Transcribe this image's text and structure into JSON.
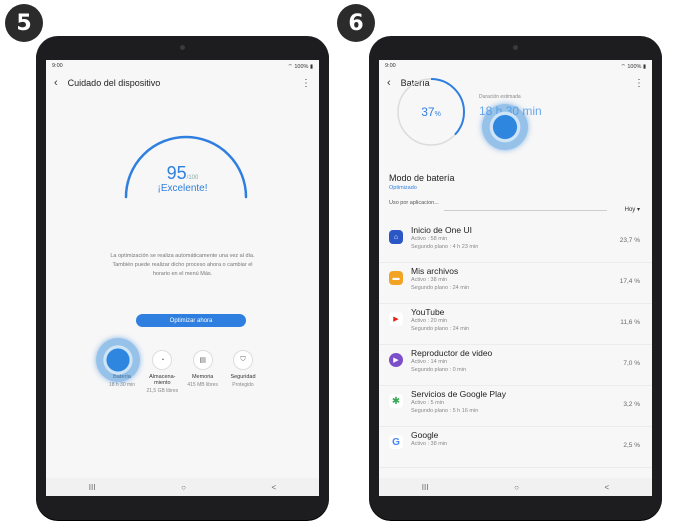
{
  "steps": {
    "left": "5",
    "right": "6"
  },
  "status": {
    "time": "9:00",
    "battery": "100%"
  },
  "icons": {
    "back": "back-arrow-icon",
    "more": "more-vert-icon",
    "recent": "recent-apps-icon",
    "home": "home-icon",
    "navback": "nav-back-icon"
  },
  "nav": {
    "recent": "III",
    "home": "○",
    "back": "<"
  },
  "device_care": {
    "title": "Cuidado del dispositivo",
    "score": "95",
    "score_max": "/100",
    "score_label": "¡Excelente!",
    "description": "La optimización se realiza automáticamente una vez al día. También puede realizar dicho proceso ahora o cambiar el horario en el menú Más.",
    "optimize_button": "Optimizar ahora",
    "categories": [
      {
        "label": "Batería",
        "value": "18 h 30 min",
        "icon": "battery-icon"
      },
      {
        "label": "Almacena-\nmiento",
        "value": "21,5 GB libres",
        "icon": "storage-icon"
      },
      {
        "label": "Memoria",
        "value": "415 MB libres",
        "icon": "memory-icon"
      },
      {
        "label": "Seguridad",
        "value": "Protegido",
        "icon": "shield-icon"
      }
    ],
    "gauge_color": "#2f7fe0"
  },
  "battery": {
    "title": "Batería",
    "percent": "37",
    "percent_unit": "%",
    "percent_fraction": 0.37,
    "duration_label": "Duración estimada",
    "duration_value": "18 h 30 min",
    "mode_title": "Modo de batería",
    "mode_value": "Optimizado",
    "usage_label": "Uso por aplicacion...",
    "usage_period": "Hoy",
    "apps": [
      {
        "name": "Inicio de One UI",
        "active": "Activo : 58 min",
        "background": "Segundo plano : 4 h 23 min",
        "percent": "23,7 %",
        "icon": "one-ui-home-icon",
        "color": "#2b56c6",
        "glyph": "⌂"
      },
      {
        "name": "Mis archivos",
        "active": "Activo : 38 min",
        "background": "Segundo plano : 24 min",
        "percent": "17,4 %",
        "icon": "folder-icon",
        "color": "#f2a324",
        "glyph": "▬"
      },
      {
        "name": "YouTube",
        "active": "Activo : 20 min",
        "background": "Segundo plano : 24 min",
        "percent": "11,6 %",
        "icon": "youtube-icon",
        "color": "#ffffff",
        "glyph": "▶"
      },
      {
        "name": "Reproductor de video",
        "active": "Activo : 14 min",
        "background": "Segundo plano : 0 min",
        "percent": "7,0 %",
        "icon": "video-player-icon",
        "color": "#7b4fc9",
        "glyph": "▶"
      },
      {
        "name": "Servicios de Google Play",
        "active": "Activo : 5 min",
        "background": "Segundo plano : 5 h 16 min",
        "percent": "3,2 %",
        "icon": "google-play-services-icon",
        "color": "#ffffff",
        "glyph": "✱"
      },
      {
        "name": "Google",
        "active": "Activo : 38 min",
        "background": "",
        "percent": "2,5 %",
        "icon": "google-icon",
        "color": "#ffffff",
        "glyph": "G"
      }
    ]
  }
}
